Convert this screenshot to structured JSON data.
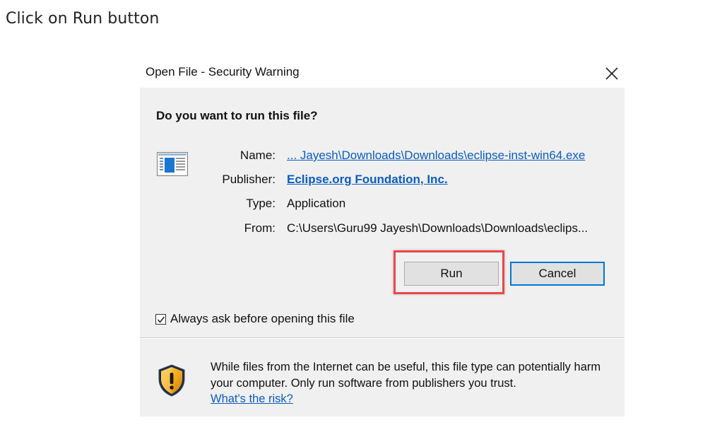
{
  "instruction": "Click on Run button",
  "dialog": {
    "title": "Open File - Security Warning",
    "question": "Do you want to run this file?",
    "fields": {
      "name_label": "Name:",
      "name_value": "... Jayesh\\Downloads\\Downloads\\eclipse-inst-win64.exe",
      "publisher_label": "Publisher:",
      "publisher_value": "Eclipse.org Foundation, Inc.",
      "type_label": "Type:",
      "type_value": "Application",
      "from_label": "From:",
      "from_value": "C:\\Users\\Guru99 Jayesh\\Downloads\\Downloads\\eclips..."
    },
    "buttons": {
      "run": "Run",
      "cancel": "Cancel"
    },
    "checkbox": {
      "label": "Always ask before opening this file",
      "checked": true
    },
    "warning": {
      "text": "While files from the Internet can be useful, this file type can potentially harm your computer. Only run software from publishers you trust.",
      "link": "What's the risk?"
    },
    "icons": {
      "app": "application-window-icon",
      "shield": "warning-shield-icon",
      "close": "close-icon"
    },
    "colors": {
      "highlight": "#e24b4b",
      "link": "#0b5cbf",
      "focus": "#0078d7",
      "shield": "#f2a81d"
    }
  }
}
